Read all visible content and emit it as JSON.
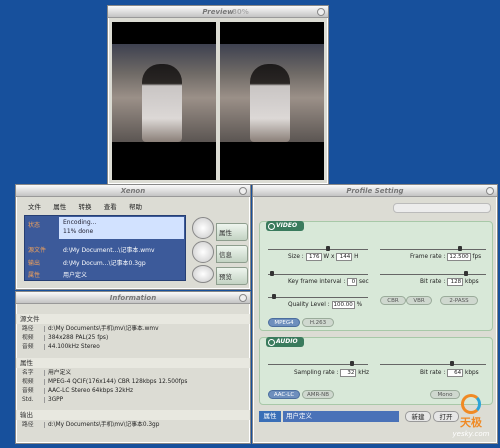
{
  "preview": {
    "title": "Preview",
    "percent": "80%"
  },
  "xenon": {
    "title": "Xenon",
    "menu": [
      "文件",
      "属性",
      "转换",
      "查看",
      "帮助"
    ],
    "status": {
      "label": "状态",
      "line1": "Encoding...",
      "line2": "11% done"
    },
    "source": {
      "label": "源文件",
      "value": "d:\\My Document...\\记事本.wmv"
    },
    "output": {
      "label": "输出",
      "value": "d:\\My Docum...\\记事本0.3gp"
    },
    "attr": {
      "label": "属性",
      "value": "用户定义"
    },
    "side_buttons": [
      "属性",
      "信息",
      "预览"
    ]
  },
  "info": {
    "title": "Information",
    "source_section": "源文件",
    "source_rows": [
      [
        "路径",
        "d:\\My Documents\\手机\\mv\\记事本.wmv"
      ],
      [
        "视频",
        "384x288 PAL(25 fps)"
      ],
      [
        "音频",
        "44.100kHz Stereo"
      ]
    ],
    "attr_section": "属性",
    "attr_rows": [
      [
        "名字",
        "用户定义"
      ],
      [
        "视频",
        "MPEG-4 QCIF(176x144) CBR 128kbps 12.500fps"
      ],
      [
        "音频",
        "AAC-LC Stereo 64kbps 32kHz"
      ],
      [
        "Std.",
        "3GPP"
      ]
    ],
    "output_section": "输出",
    "output_rows": [
      [
        "路径",
        "d:\\My Documents\\手机\\mv\\记事本0.3gp"
      ]
    ]
  },
  "profile": {
    "title": "Profile Setting",
    "video_label": "VIDEO",
    "size_label": "Size :",
    "size_w": "176",
    "size_x": "W x",
    "size_h": "144",
    "size_h_unit": "H",
    "frame_rate_label": "Frame rate :",
    "frame_rate": "12.500",
    "frame_rate_unit": "fps",
    "keyframe_label": "Key frame interval :",
    "keyframe": "0",
    "keyframe_unit": "sec",
    "bitrate_label": "Bit rate :",
    "bitrate": "128",
    "bitrate_unit": "kbps",
    "quality_label": "Quality Level :",
    "quality": "100.00",
    "quality_unit": "%",
    "rate_modes": [
      "CBR",
      "VBR",
      "2-PASS"
    ],
    "video_codecs": [
      "MPEG4",
      "H.263"
    ],
    "audio_label": "AUDIO",
    "sampling_label": "Sampling rate :",
    "sampling": "32",
    "sampling_unit": "kHz",
    "audio_bitrate_label": "Bit rate :",
    "audio_bitrate": "64",
    "audio_bitrate_unit": "kbps",
    "audio_codecs": [
      "AAC-LC",
      "AMR-NB"
    ],
    "mono_label": "Mono",
    "attr_label": "属性",
    "attr_value": "用户定义",
    "new_button": "新建",
    "open_button": "打开"
  },
  "watermark": {
    "brand": "天极",
    "site": "yesky.com"
  }
}
